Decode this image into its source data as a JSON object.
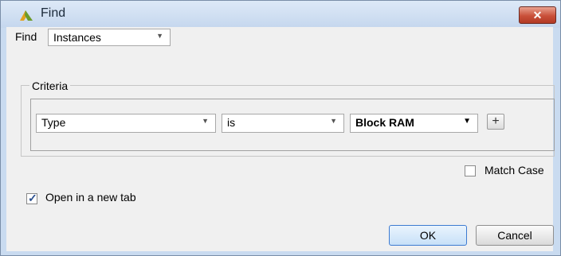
{
  "window": {
    "title": "Find",
    "close_symbol": "✕"
  },
  "find": {
    "label": "Find",
    "selected": "Instances"
  },
  "criteria": {
    "label": "Criteria",
    "field": "Type",
    "operator": "is",
    "value": "Block RAM",
    "add_symbol": "+"
  },
  "options": {
    "match_case_label": "Match Case",
    "match_case_checked": false,
    "open_new_tab_label": "Open in a new tab",
    "open_new_tab_checked": true
  },
  "buttons": {
    "ok": "OK",
    "cancel": "Cancel"
  },
  "icons": {
    "app": "vivado-logo-icon",
    "dropdown": "chevron-down-icon"
  }
}
